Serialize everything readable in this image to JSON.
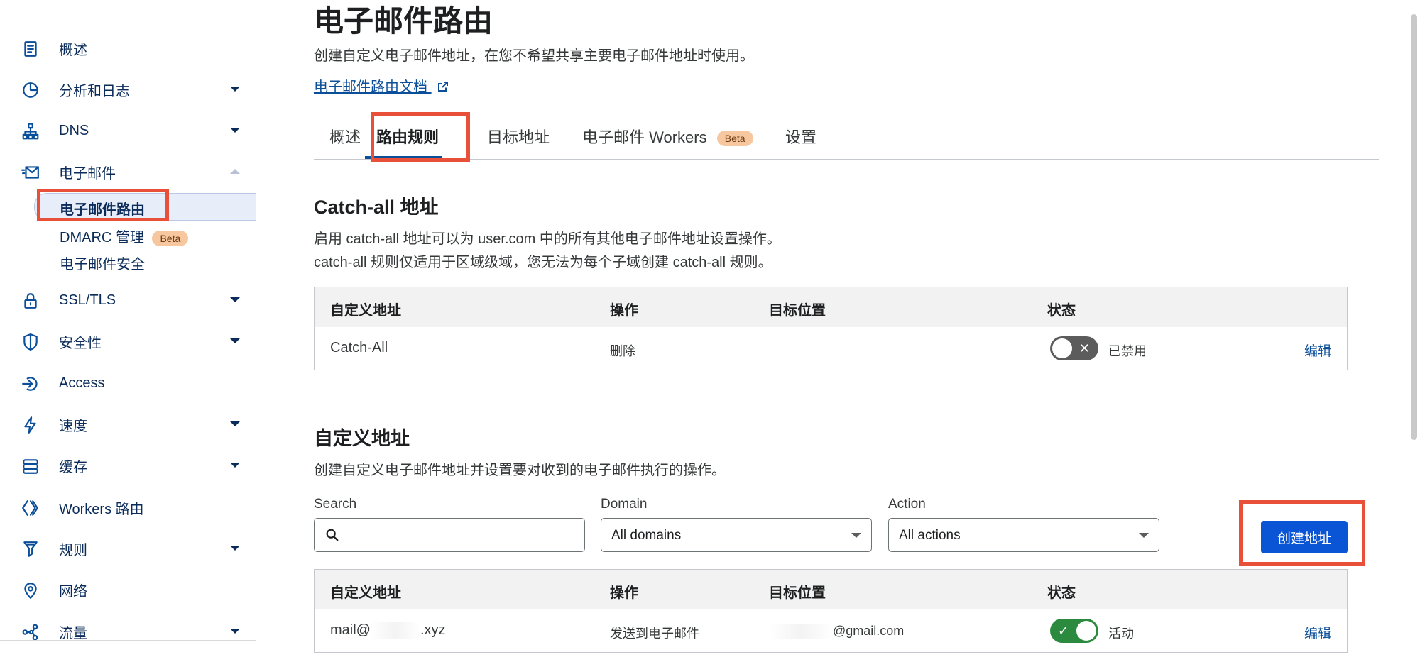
{
  "sidebar": {
    "items": [
      {
        "label": "概述",
        "icon": "document-icon"
      },
      {
        "label": "分析和日志",
        "icon": "pie-chart-icon"
      },
      {
        "label": "DNS",
        "icon": "network-icon"
      },
      {
        "label": "电子邮件",
        "icon": "email-icon"
      },
      {
        "label": "SSL/TLS",
        "icon": "lock-icon"
      },
      {
        "label": "安全性",
        "icon": "shield-icon"
      },
      {
        "label": "Access",
        "icon": "access-icon"
      },
      {
        "label": "速度",
        "icon": "lightning-icon"
      },
      {
        "label": "缓存",
        "icon": "storage-icon"
      },
      {
        "label": "Workers 路由",
        "icon": "workers-icon"
      },
      {
        "label": "规则",
        "icon": "funnel-icon"
      },
      {
        "label": "网络",
        "icon": "location-pin-icon"
      },
      {
        "label": "流量",
        "icon": "share-nodes-icon"
      }
    ],
    "email_sub": {
      "active": "电子邮件路由",
      "dmarc": "DMARC 管理",
      "dmarc_badge": "Beta",
      "security": "电子邮件安全"
    }
  },
  "header": {
    "title": "电子邮件路由",
    "description": "创建自定义电子邮件地址，在您不希望共享主要电子邮件地址时使用。",
    "doc_link": "电子邮件路由文档"
  },
  "tabs": [
    {
      "label": "概述"
    },
    {
      "label": "路由规则",
      "active": true
    },
    {
      "label": "目标地址"
    },
    {
      "label": "电子邮件 Workers",
      "badge": "Beta"
    },
    {
      "label": "设置"
    }
  ],
  "catchall": {
    "title": "Catch-all 地址",
    "desc_line1": "启用 catch-all 地址可以为 user.com 中的所有其他电子邮件地址设置操作。",
    "desc_line2": "catch-all 规则仅适用于区域级域，您无法为每个子域创建 catch-all 规则。",
    "columns": [
      "自定义地址",
      "操作",
      "目标位置",
      "状态"
    ],
    "row": {
      "address": "Catch-All",
      "action": "删除",
      "destination": "",
      "status_text": "已禁用",
      "enabled": false,
      "edit": "编辑"
    }
  },
  "custom": {
    "title": "自定义地址",
    "desc": "创建自定义电子邮件地址并设置要对收到的电子邮件执行的操作。",
    "filters": {
      "search_label": "Search",
      "search_value": "",
      "domain_label": "Domain",
      "domain_value": "All domains",
      "action_label": "Action",
      "action_value": "All actions"
    },
    "create_button": "创建地址",
    "columns": [
      "自定义地址",
      "操作",
      "目标位置",
      "状态"
    ],
    "rows": [
      {
        "address_prefix": "mail@",
        "address_suffix": ".xyz",
        "action": "发送到电子邮件",
        "destination": "@gmail.com",
        "status_text": "活动",
        "enabled": true,
        "edit": "编辑"
      }
    ]
  },
  "colors": {
    "accent": "#0a55d6",
    "link": "#0b4f9a",
    "highlight": "#e8503a",
    "toggle_on": "#2b8a3e",
    "toggle_off": "#5c5c5c",
    "beta_bg": "#f7c7a0"
  }
}
